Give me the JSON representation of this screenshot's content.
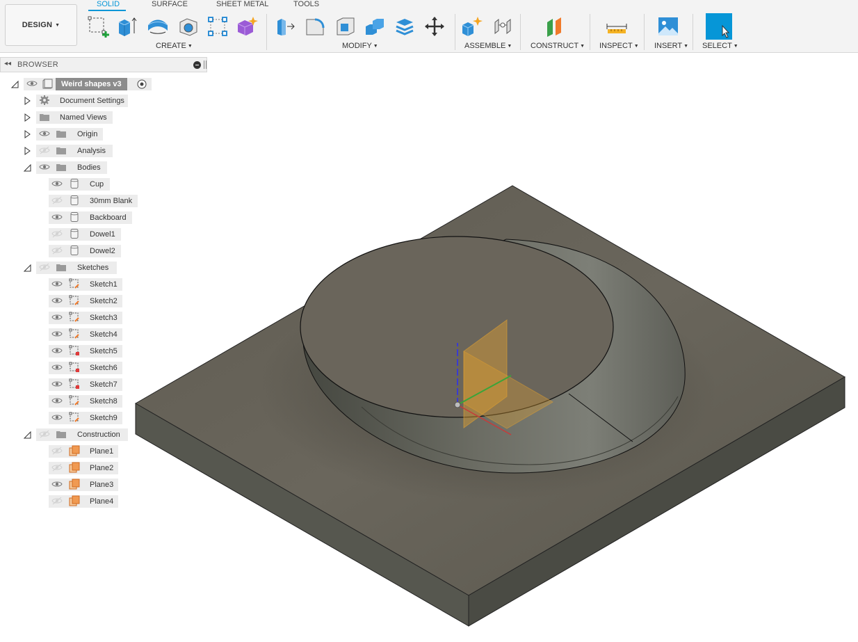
{
  "toolbar": {
    "design_label": "DESIGN",
    "tabs": [
      {
        "label": "SOLID",
        "active": true
      },
      {
        "label": "SURFACE",
        "active": false
      },
      {
        "label": "SHEET METAL",
        "active": false
      },
      {
        "label": "TOOLS",
        "active": false
      }
    ],
    "groups": {
      "create": "CREATE",
      "modify": "MODIFY",
      "assemble": "ASSEMBLE",
      "construct": "CONSTRUCT",
      "inspect": "INSPECT",
      "insert": "INSERT",
      "select": "SELECT"
    },
    "accent_color": "#0696d7"
  },
  "browser": {
    "title": "BROWSER",
    "root": "Weird shapes v3",
    "items": {
      "document_settings": "Document Settings",
      "named_views": "Named Views",
      "origin": "Origin",
      "analysis": "Analysis",
      "bodies": "Bodies",
      "sketches": "Sketches",
      "construction": "Construction"
    },
    "bodies": [
      "Cup",
      "30mm Blank",
      "Backboard",
      "Dowel1",
      "Dowel2"
    ],
    "sketches": [
      "Sketch1",
      "Sketch2",
      "Sketch3",
      "Sketch4",
      "Sketch5",
      "Sketch6",
      "Sketch7",
      "Sketch8",
      "Sketch9"
    ],
    "planes": [
      "Plane1",
      "Plane2",
      "Plane3",
      "Plane4"
    ]
  }
}
